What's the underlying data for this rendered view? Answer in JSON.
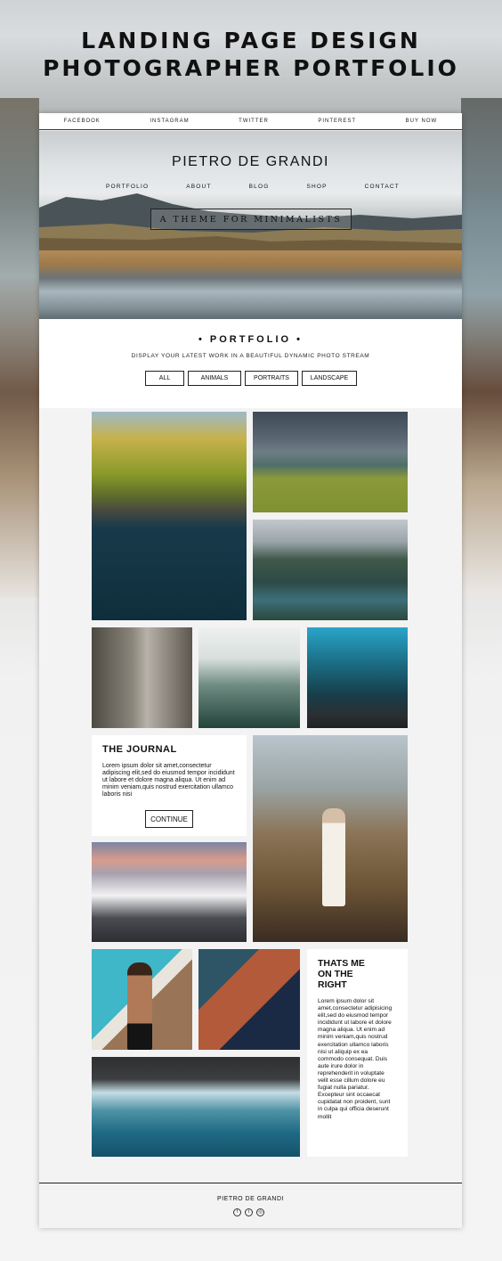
{
  "banner": {
    "line1": "LANDING PAGE DESIGN",
    "line2": "PHOTOGRAPHER PORTFOLIO"
  },
  "social_nav": [
    "FACEBOOK",
    "INSTAGRAM",
    "TWITTER",
    "PINTEREST",
    "BUY NOW"
  ],
  "header": {
    "brand": "PIETRO DE GRANDI",
    "nav": [
      "PORTFOLIO",
      "ABOUT",
      "BLOG",
      "SHOP",
      "CONTACT"
    ],
    "tagline": "A THEME FOR MINIMALISTS"
  },
  "portfolio": {
    "title": "•   PORTFOLIO   •",
    "subtitle": "DISPLAY YOUR LATEST WORK IN A BEAUTIFUL DYNAMIC PHOTO STREAM",
    "filters": [
      "ALL",
      "ANIMALS",
      "PORTRAITS",
      "LANDSCAPE"
    ]
  },
  "journal": {
    "title": "THE JOURNAL",
    "text": "Lorem ipsum dolor sit amet,consectetur adipiscing elit,sed do eiusmod tempor incididunt ut labore et dolore magna aliqua. Ut enim ad minim veniam,quis nostrud exercitation ullamco laboris nisi",
    "button": "CONTINUE"
  },
  "about": {
    "title_line1": "THATS ME",
    "title_line2": "ON THE",
    "title_line3": "RIGHT",
    "text": "Lorem ipsum dolor sit amet,consectetur adipisicing elit,sed do eiusmod tempor incididunt ut labore et dolore magna aliqua. Ut enim ad minim veniam,quis nostrud exercitation ullamco laboris nisi ut aliquip ex ea commodo consequat. Duis aute irure dolor in reprehenderit in voluptate velit esse cillum dolore eu fugiat nulla pariatur. Excepteur sint occaecat cupidatat non proident, sunt in culpa qui officia deserunt mollit"
  },
  "footer": {
    "brand": "PIETRO DE GRANDI",
    "icons": [
      "facebook-icon",
      "twitter-icon",
      "instagram-icon"
    ]
  }
}
